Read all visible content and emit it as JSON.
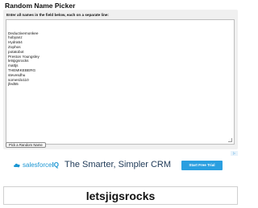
{
  "page": {
    "title": "Random Name Picker",
    "instructions": "Enter all names in the field below, each on a separate line:"
  },
  "names": [
    "Deductivemonkee",
    "hobyanz",
    "Hydra54",
    "Zophos",
    "potatobot",
    "Preston Youngsley",
    "letsjigsrocks",
    "mattjs",
    "THEMIKEBERG",
    "stevesdhu",
    "somerdo110",
    "jfed55"
  ],
  "pick_button": {
    "label": "Pick a Random Name"
  },
  "ad": {
    "brand": "salesforce",
    "brand_suffix": "IQ",
    "headline": "The Smarter, Simpler CRM",
    "cta": "Start Free Trial",
    "ad_choices_icon": "ad-choices-icon",
    "brand_color": "#1b96d3",
    "cta_color": "#2a9fe0"
  },
  "result": {
    "name": "letsjigsrocks"
  }
}
